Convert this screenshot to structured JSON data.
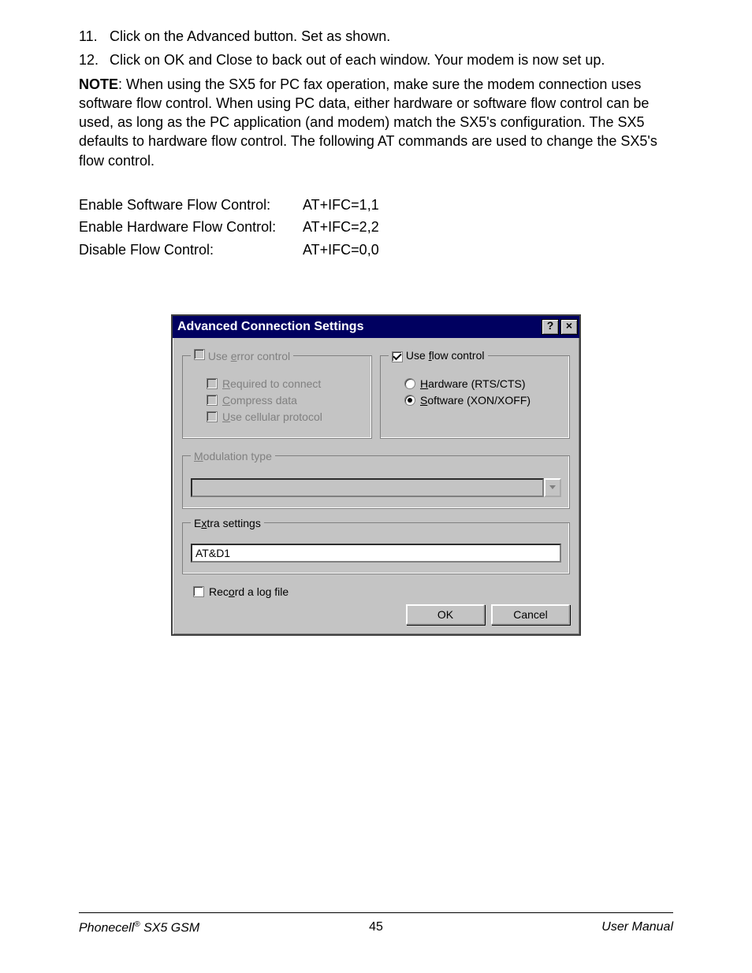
{
  "steps": [
    {
      "num": "11.",
      "text": "Click on the Advanced button. Set as shown."
    },
    {
      "num": "12.",
      "text": "Click on OK and Close to back out of each window. Your modem is now set up."
    }
  ],
  "note_label": "NOTE",
  "note_text": ": When using the SX5 for PC fax operation, make sure the modem connection uses software flow control. When using PC data, either hardware or software flow control can be used, as long as the PC application (and modem) match the SX5's configuration. The SX5 defaults to hardware flow control. The following AT commands are used to change the SX5's flow control.",
  "at_commands": [
    {
      "label": "Enable Software Flow Control:",
      "cmd": "AT+IFC=1,1"
    },
    {
      "label": "Enable Hardware Flow Control:",
      "cmd": "AT+IFC=2,2"
    },
    {
      "label": "Disable Flow Control:",
      "cmd": "AT+IFC=0,0"
    }
  ],
  "dialog": {
    "title": "Advanced Connection Settings",
    "help_glyph": "?",
    "close_glyph": "×",
    "error_legend_pre": "Use ",
    "error_legend_u": "e",
    "error_legend_post": "rror control",
    "err_required_u": "R",
    "err_required_post": "equired to connect",
    "err_compress_u": "C",
    "err_compress_post": "ompress data",
    "err_cellular_u": "U",
    "err_cellular_post": "se cellular protocol",
    "flow_legend_pre": "Use ",
    "flow_legend_u": "f",
    "flow_legend_post": "low control",
    "flow_hardware_u": "H",
    "flow_hardware_post": "ardware (RTS/CTS)",
    "flow_software_u": "S",
    "flow_software_post": "oftware (XON/XOFF)",
    "modulation_legend_u": "M",
    "modulation_legend_post": "odulation type",
    "extra_legend_pre": "E",
    "extra_legend_u": "x",
    "extra_legend_post": "tra settings",
    "extra_value": "AT&D1",
    "record_log_pre": "Rec",
    "record_log_u": "o",
    "record_log_post": "rd a log file",
    "ok": "OK",
    "cancel": "Cancel"
  },
  "footer": {
    "left_brand": "Phonecell",
    "left_reg": "®",
    "left_model": " SX5 GSM",
    "page": "45",
    "right": "User Manual"
  }
}
